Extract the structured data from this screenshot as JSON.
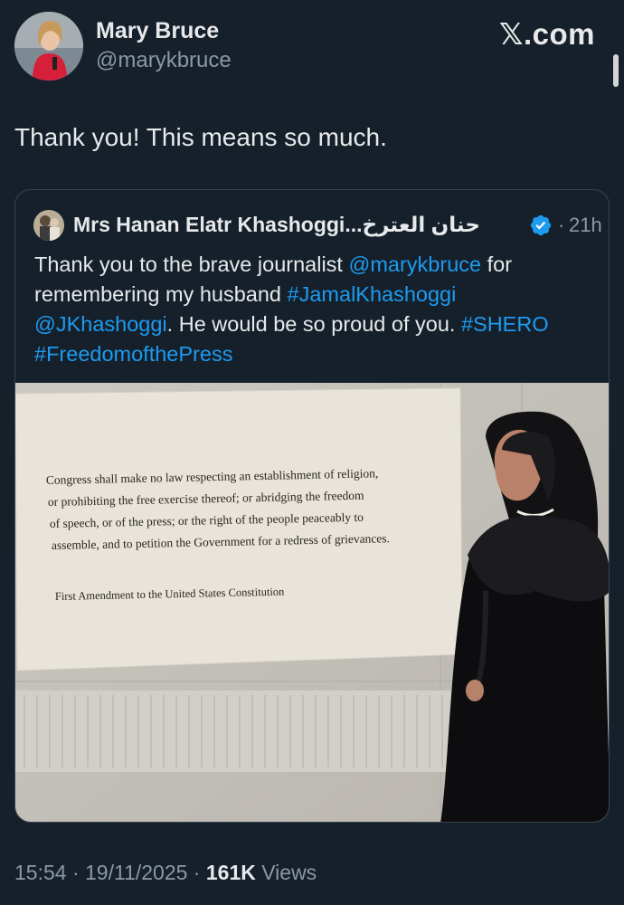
{
  "brand": {
    "logo_mark": "𝕏",
    "logo_text": ".com"
  },
  "author": {
    "name": "Mary Bruce",
    "handle": "@marykbruce"
  },
  "tweet": {
    "text": "Thank you! This means so much."
  },
  "quoted": {
    "author_name": "Mrs Hanan Elatr Khashoggi...حنان العترخ",
    "verified_icon": "verified-badge-icon",
    "separator": "·",
    "time": "21h",
    "text": {
      "p1": "Thank you to the brave journalist ",
      "mention1": "@marykbruce",
      "p2": " for",
      "p3": "remembering my husband ",
      "hashtag1": "#JamalKhashoggi",
      "mention2": "@JKhashoggi",
      "p4": ".  He would be so proud of you. ",
      "hashtag2": "#SHERO",
      "hashtag3": "#FreedomofthePress"
    },
    "image": {
      "plaque_lines": [
        "Congress shall make no law respecting an establishment of religion,",
        "or prohibiting the free exercise thereof; or abridging the freedom",
        "of speech, or of the press; or the right of the people peaceably to",
        "assemble, and to petition the Government for a redress of grievances."
      ],
      "plaque_attribution": "First Amendment to the United States Constitution"
    }
  },
  "footer": {
    "time": "15:54",
    "sep1": " · ",
    "date": "19/11/2025",
    "sep2": " · ",
    "views_count": "161K",
    "views_label": " Views"
  },
  "colors": {
    "background": "#15202b",
    "link": "#1d9bf0",
    "muted": "#8b98a5",
    "text": "#e7e9ea",
    "border": "#38444d"
  }
}
